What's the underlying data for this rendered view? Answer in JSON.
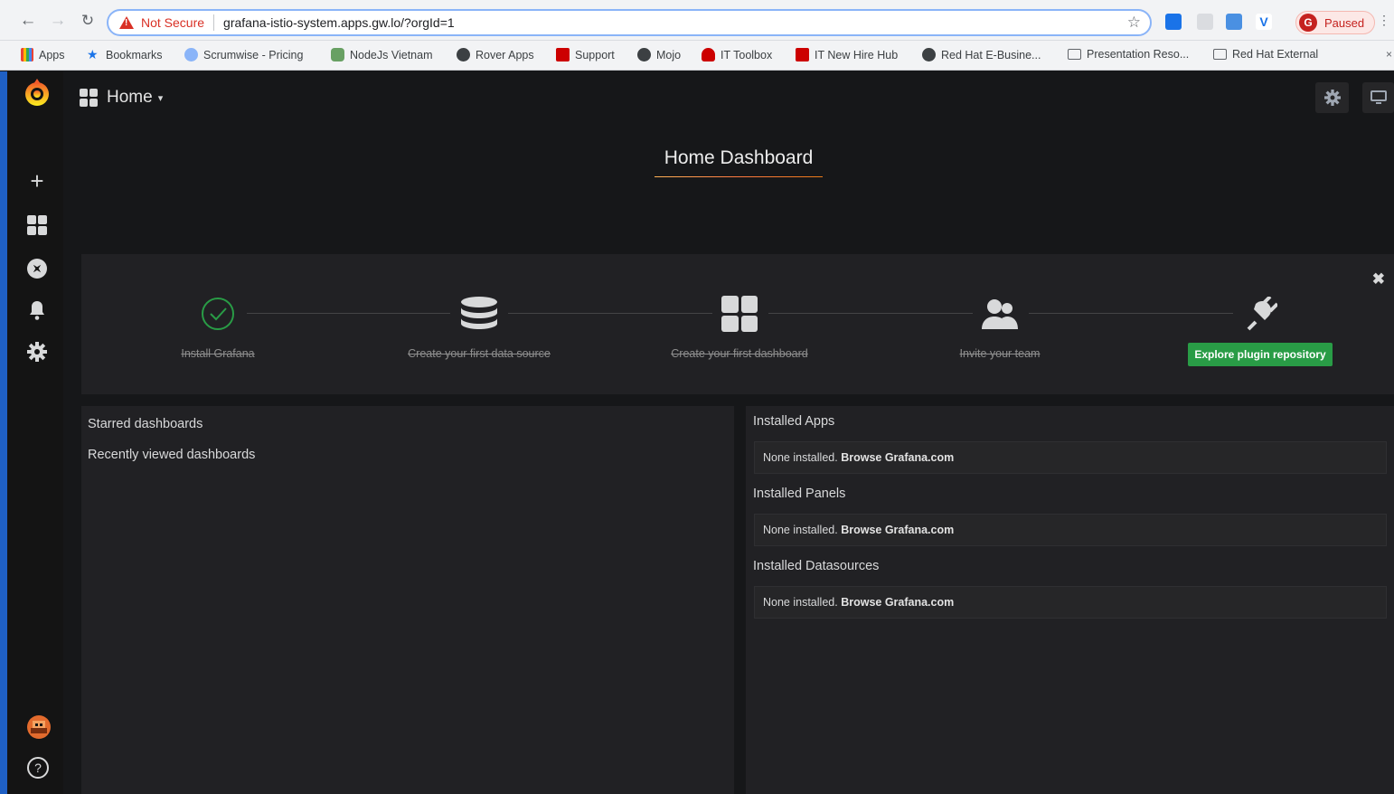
{
  "browser": {
    "not_secure": "Not Secure",
    "url": "grafana-istio-system.apps.gw.lo/?orgId=1",
    "profile_initial": "G",
    "profile_status": "Paused"
  },
  "bookmarks": [
    {
      "label": "Apps"
    },
    {
      "label": "Bookmarks"
    },
    {
      "label": "Scrumwise - Pricing"
    },
    {
      "label": "NodeJs Vietnam"
    },
    {
      "label": "Rover Apps"
    },
    {
      "label": "Support"
    },
    {
      "label": "Mojo"
    },
    {
      "label": "IT Toolbox"
    },
    {
      "label": "IT New Hire Hub"
    },
    {
      "label": "Red Hat E-Busine..."
    },
    {
      "label": "Presentation Reso..."
    },
    {
      "label": "Red Hat External"
    }
  ],
  "dashboard": {
    "breadcrumb": "Home",
    "title": "Home Dashboard"
  },
  "getting_started": {
    "steps": [
      {
        "label": "Install Grafana"
      },
      {
        "label": "Create your first data source"
      },
      {
        "label": "Create your first dashboard"
      },
      {
        "label": "Invite your team"
      }
    ],
    "cta": "Explore plugin repository"
  },
  "left_panel": {
    "starred": "Starred dashboards",
    "recent": "Recently viewed dashboards"
  },
  "plugins": {
    "apps_heading": "Installed Apps",
    "panels_heading": "Installed Panels",
    "datasources_heading": "Installed Datasources",
    "none_text": "None installed.",
    "browse_text": "Browse Grafana.com"
  },
  "colors": {
    "accent_green": "#299c46",
    "brand_orange": "#eb7b18",
    "background": "#161719"
  }
}
